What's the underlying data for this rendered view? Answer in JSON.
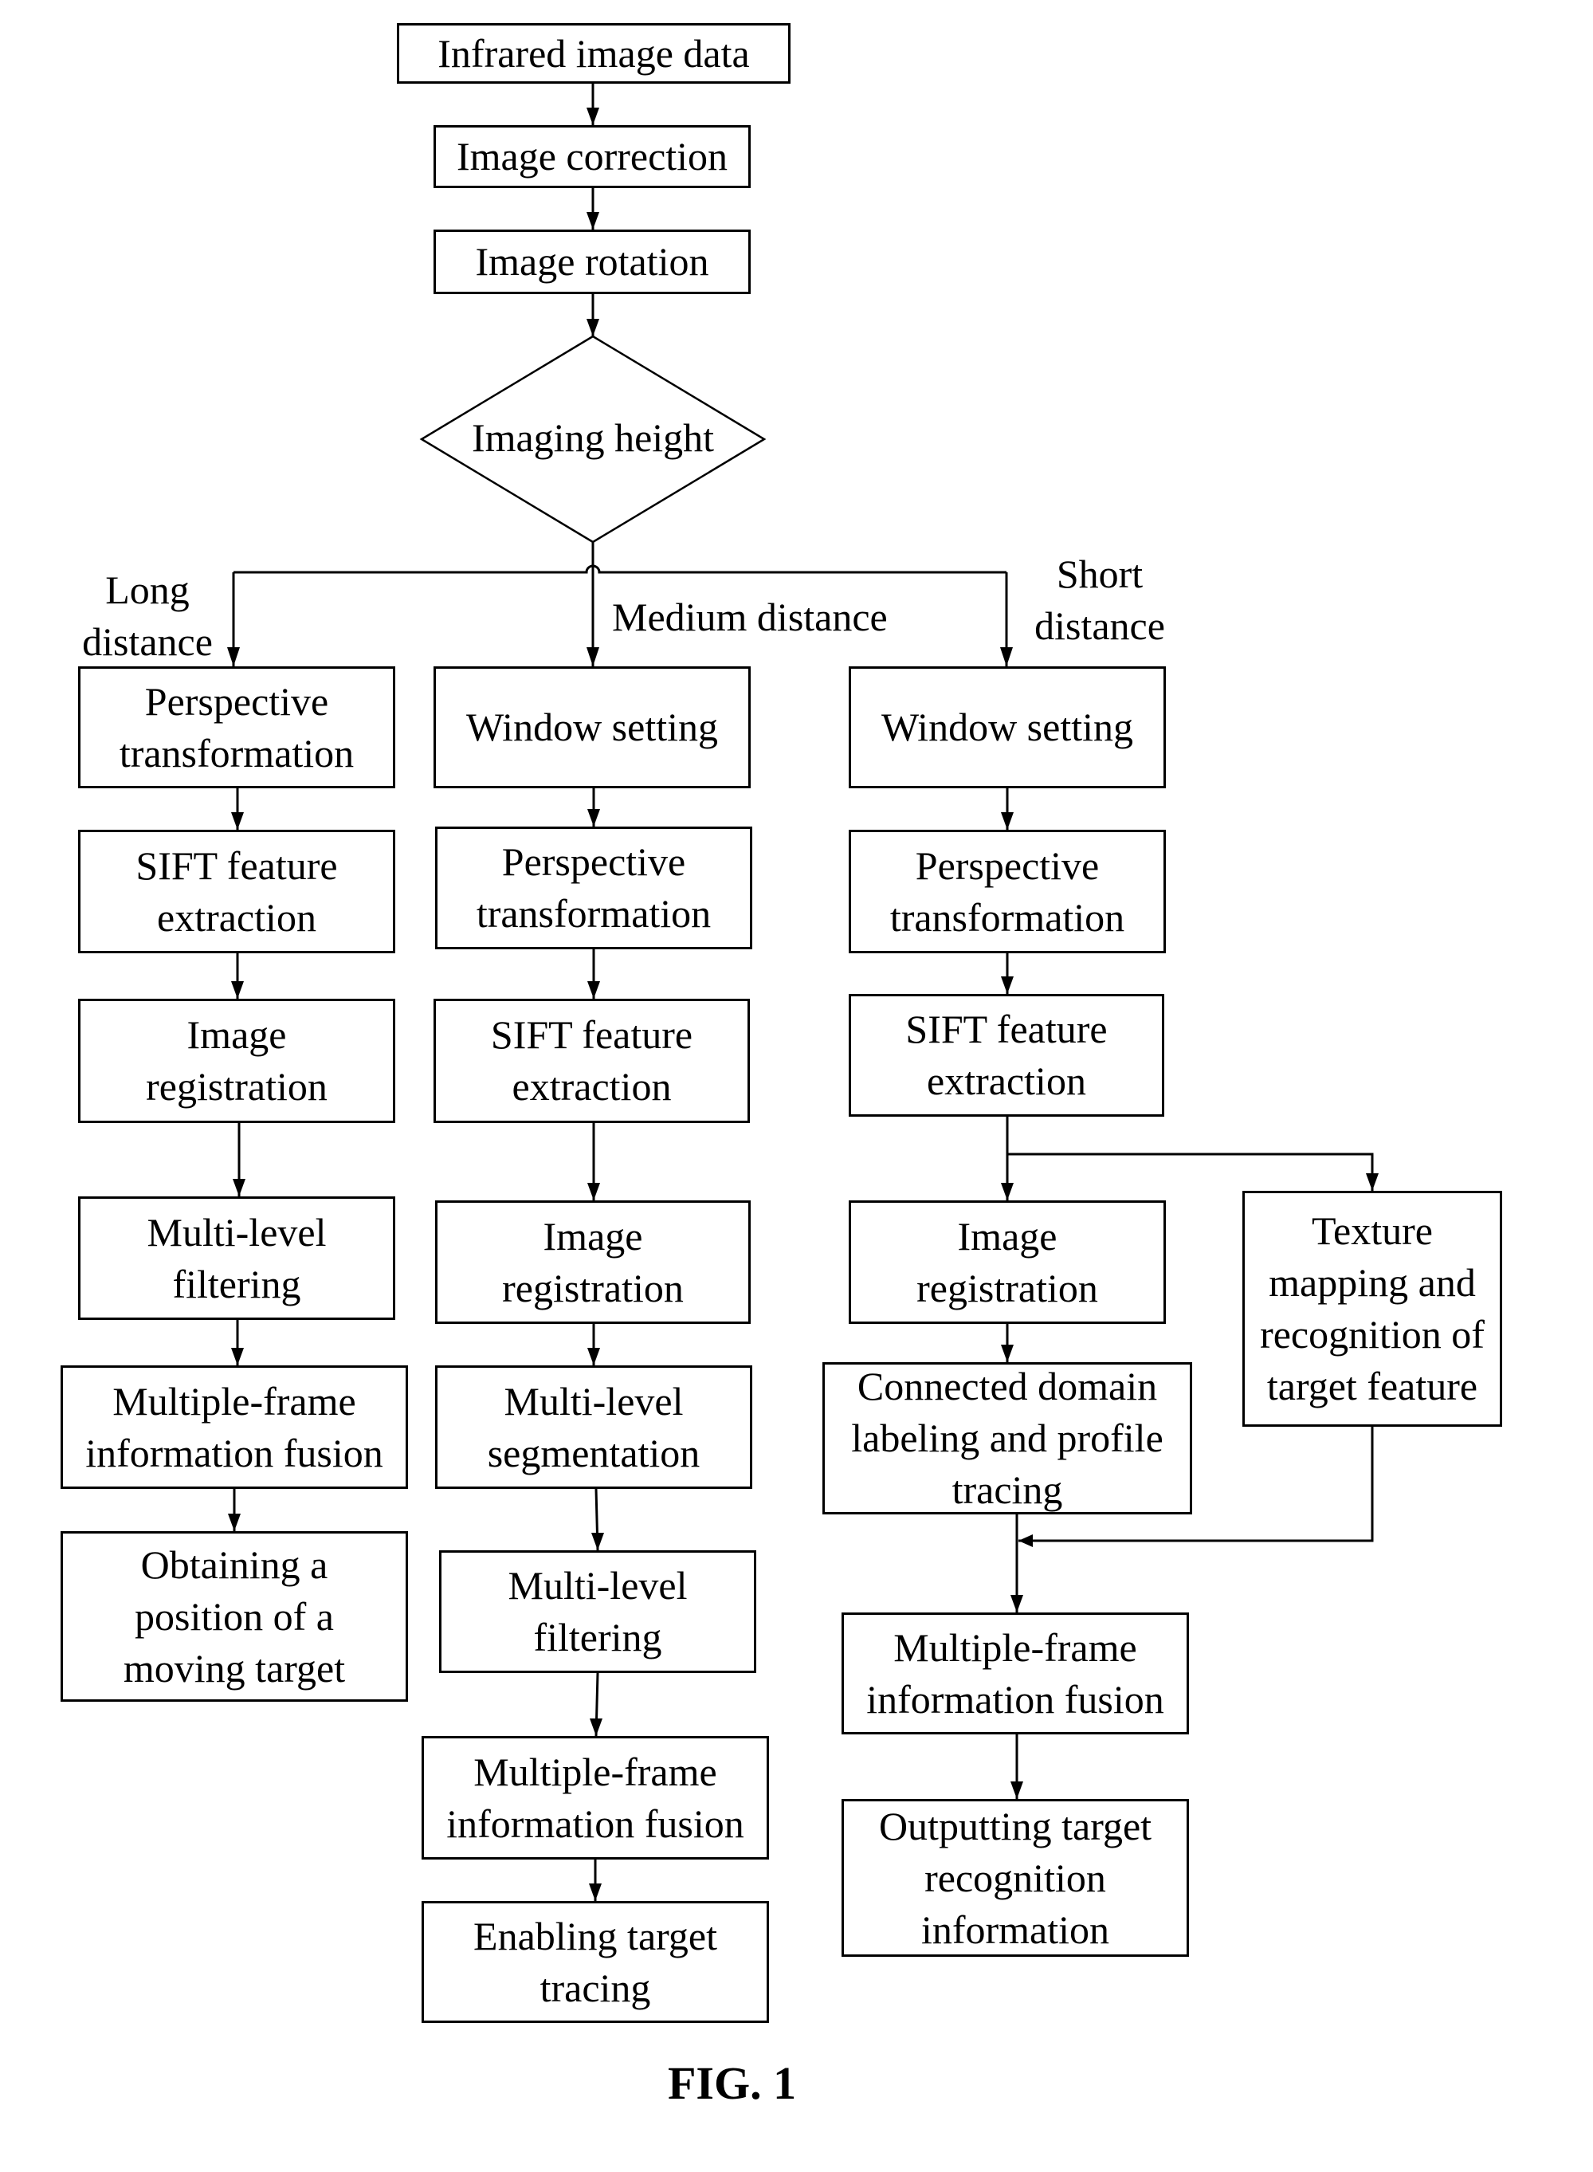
{
  "caption": "FIG. 1",
  "top": {
    "start": "Infrared image data",
    "correction": "Image correction",
    "rotation": "Image rotation",
    "decision": "Imaging height"
  },
  "branch_labels": {
    "long": "Long\ndistance",
    "medium": "Medium distance",
    "short": "Short\ndistance"
  },
  "long_branch": [
    "Perspective\ntransformation",
    "SIFT feature\nextraction",
    "Image\nregistration",
    "Multi-level\nfiltering",
    "Multiple-frame\ninformation fusion",
    "Obtaining a\nposition of a\nmoving target"
  ],
  "medium_branch": [
    "Window setting",
    "Perspective\ntransformation",
    "SIFT feature\nextraction",
    "Image\nregistration",
    "Multi-level\nsegmentation",
    "Multi-level\nfiltering",
    "Multiple-frame\ninformation fusion",
    "Enabling target\ntracing"
  ],
  "short_branch": [
    "Window setting",
    "Perspective\ntransformation",
    "SIFT feature\nextraction",
    "Image\nregistration",
    "Connected domain\nlabeling and profile\ntracing",
    "Multiple-frame\ninformation fusion",
    "Outputting target\nrecognition\ninformation"
  ],
  "short_side_branch": "Texture\nmapping and\nrecognition of\ntarget feature"
}
